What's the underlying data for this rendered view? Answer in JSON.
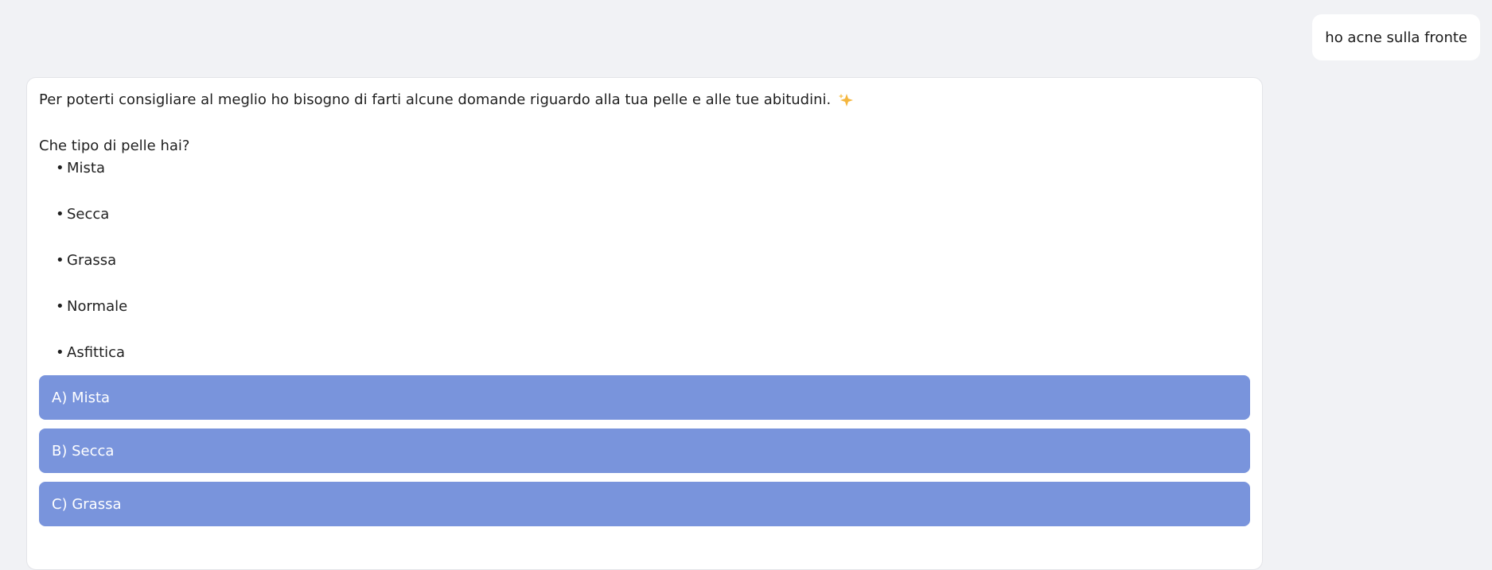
{
  "user_message": "ho acne sulla fronte",
  "assistant": {
    "intro": "Per poterti consigliare al meglio ho bisogno di farti alcune domande riguardo alla tua pelle e alle tue abitudini.",
    "intro_icon": "sparkles-icon",
    "question": "Che tipo di pelle hai?",
    "options": [
      "Mista",
      "Secca",
      "Grassa",
      "Normale",
      "Asfittica"
    ],
    "buttons": [
      "A) Mista",
      "B) Secca",
      "C) Grassa"
    ]
  },
  "colors": {
    "background": "#f1f2f5",
    "card": "#ffffff",
    "choice_button": "#7994dc",
    "sparkle": "#f4b63e"
  }
}
